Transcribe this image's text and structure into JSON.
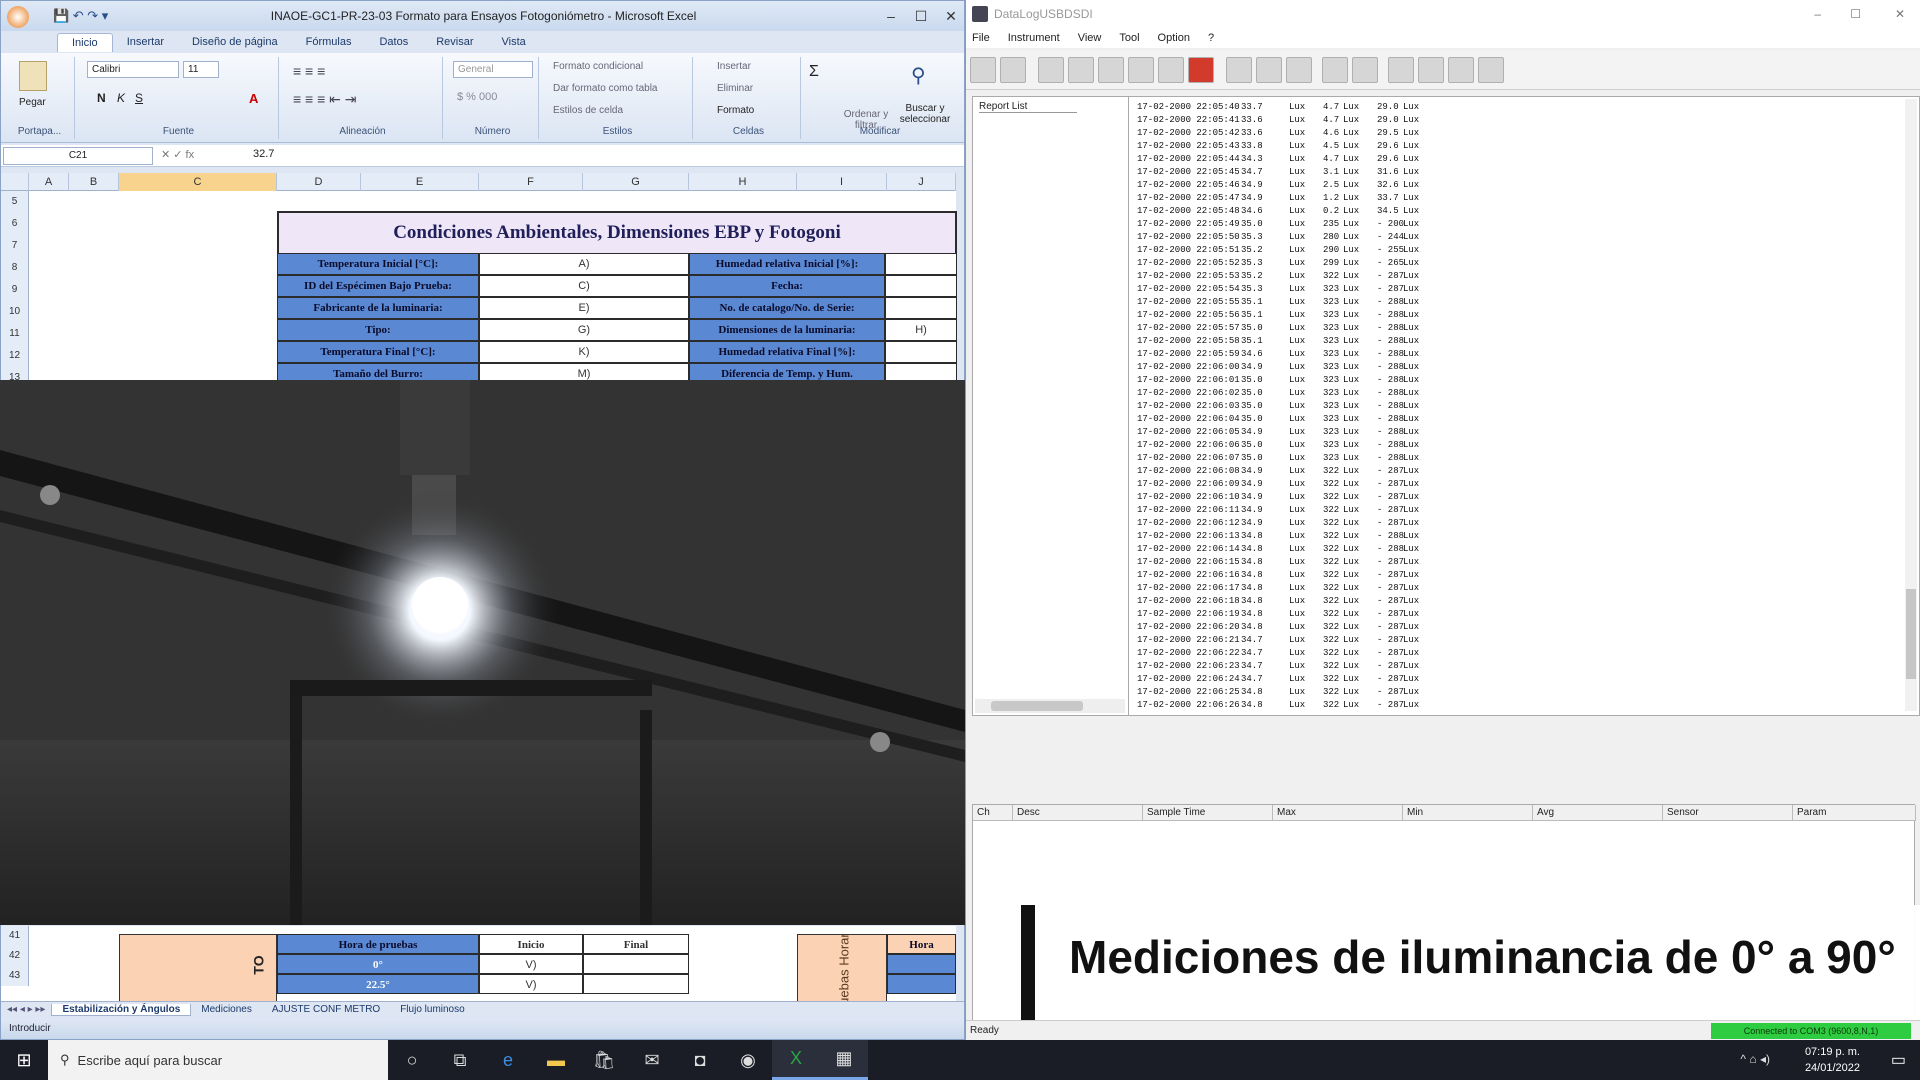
{
  "excel": {
    "title": "INAOE-GC1-PR-23-03 Formato para Ensayos Fotogoniómetro - Microsoft Excel",
    "tabs": [
      "Inicio",
      "Insertar",
      "Diseño de página",
      "Fórmulas",
      "Datos",
      "Revisar",
      "Vista"
    ],
    "ribbon": {
      "paste": "Pegar",
      "font_name": "Calibri",
      "font_size": "11",
      "number_format": "General",
      "groups": [
        "Portapa...",
        "Fuente",
        "Alineación",
        "Número",
        "Estilos",
        "Celdas",
        "Modificar"
      ],
      "styles_items": [
        "Formato condicional",
        "Dar formato como tabla",
        "Estilos de celda"
      ],
      "cells_items": [
        "Insertar",
        "Eliminar",
        "Formato"
      ],
      "edit_items": [
        "Ordenar y filtrar",
        "Buscar y seleccionar"
      ]
    },
    "name_box": "C21",
    "formula": "32.7",
    "columns": [
      "A",
      "B",
      "C",
      "D",
      "E",
      "F",
      "G",
      "H",
      "I",
      "J"
    ],
    "rows": [
      "5",
      "6",
      "7",
      "8",
      "9",
      "10",
      "11",
      "12",
      "13"
    ],
    "table_title": "Condiciones Ambientales, Dimensiones EBP y Fotogoni",
    "table_rows": [
      {
        "label": "Temperatura Inicial [°C]:",
        "value": "A)",
        "label2": "Humedad relativa Inicial [%]:",
        "value2": ""
      },
      {
        "label": "ID del Espécimen Bajo Prueba:",
        "value": "C)",
        "label2": "Fecha:",
        "value2": ""
      },
      {
        "label": "Fabricante de la luminaria:",
        "value": "E)",
        "label2": "No. de catalogo/No. de Serie:",
        "value2": ""
      },
      {
        "label": "Tipo:",
        "value": "G)",
        "label2": "Dimensiones de la luminaria:",
        "value2": "H)"
      },
      {
        "label": "Temperatura Final [°C]:",
        "value": "K)",
        "label2": "Humedad relativa Final [%]:",
        "value2": ""
      },
      {
        "label": "Tamaño del Burro:",
        "value": "M)",
        "label2": "Diferencia de Temp. y Hum.",
        "value2": ""
      }
    ],
    "bottom_rows": [
      "41",
      "42",
      "43"
    ],
    "bottom_table": {
      "header": [
        "Hora de pruebas",
        "Inicio",
        "Final"
      ],
      "rows": [
        [
          "0°",
          "V)",
          ""
        ],
        [
          "22.5°",
          "V)",
          ""
        ]
      ],
      "side_label": "Pruebas Horario",
      "side_header": "Hora"
    },
    "sheet_tabs": [
      "Estabilización y Ángulos",
      "Mediciones",
      "AJUSTE CONF METRO",
      "Flujo luminoso"
    ],
    "status": "Introducir"
  },
  "datalogger": {
    "title": "DataLogUSBDSDI",
    "menu": [
      "File",
      "Instrument",
      "View",
      "Tool",
      "Option",
      "?"
    ],
    "tree_label": "Report List",
    "rows": [
      [
        "17-02-2000 22:05:40",
        "33.7",
        "Lux",
        "4.7",
        "Lux",
        "29.0",
        "Lux"
      ],
      [
        "17-02-2000 22:05:41",
        "33.6",
        "Lux",
        "4.7",
        "Lux",
        "29.0",
        "Lux"
      ],
      [
        "17-02-2000 22:05:42",
        "33.6",
        "Lux",
        "4.6",
        "Lux",
        "29.5",
        "Lux"
      ],
      [
        "17-02-2000 22:05:43",
        "33.8",
        "Lux",
        "4.5",
        "Lux",
        "29.6",
        "Lux"
      ],
      [
        "17-02-2000 22:05:44",
        "34.3",
        "Lux",
        "4.7",
        "Lux",
        "29.6",
        "Lux"
      ],
      [
        "17-02-2000 22:05:45",
        "34.7",
        "Lux",
        "3.1",
        "Lux",
        "31.6",
        "Lux"
      ],
      [
        "17-02-2000 22:05:46",
        "34.9",
        "Lux",
        "2.5",
        "Lux",
        "32.6",
        "Lux"
      ],
      [
        "17-02-2000 22:05:47",
        "34.9",
        "Lux",
        "1.2",
        "Lux",
        "33.7",
        "Lux"
      ],
      [
        "17-02-2000 22:05:48",
        "34.6",
        "Lux",
        "0.2",
        "Lux",
        "34.5",
        "Lux"
      ],
      [
        "17-02-2000 22:05:49",
        "35.0",
        "Lux",
        "235",
        "Lux",
        "- 200",
        "Lux"
      ],
      [
        "17-02-2000 22:05:50",
        "35.3",
        "Lux",
        "280",
        "Lux",
        "- 244",
        "Lux"
      ],
      [
        "17-02-2000 22:05:51",
        "35.2",
        "Lux",
        "290",
        "Lux",
        "- 255",
        "Lux"
      ],
      [
        "17-02-2000 22:05:52",
        "35.3",
        "Lux",
        "299",
        "Lux",
        "- 265",
        "Lux"
      ],
      [
        "17-02-2000 22:05:53",
        "35.2",
        "Lux",
        "322",
        "Lux",
        "- 287",
        "Lux"
      ],
      [
        "17-02-2000 22:05:54",
        "35.3",
        "Lux",
        "323",
        "Lux",
        "- 287",
        "Lux"
      ],
      [
        "17-02-2000 22:05:55",
        "35.1",
        "Lux",
        "323",
        "Lux",
        "- 288",
        "Lux"
      ],
      [
        "17-02-2000 22:05:56",
        "35.1",
        "Lux",
        "323",
        "Lux",
        "- 288",
        "Lux"
      ],
      [
        "17-02-2000 22:05:57",
        "35.0",
        "Lux",
        "323",
        "Lux",
        "- 288",
        "Lux"
      ],
      [
        "17-02-2000 22:05:58",
        "35.1",
        "Lux",
        "323",
        "Lux",
        "- 288",
        "Lux"
      ],
      [
        "17-02-2000 22:05:59",
        "34.6",
        "Lux",
        "323",
        "Lux",
        "- 288",
        "Lux"
      ],
      [
        "17-02-2000 22:06:00",
        "34.9",
        "Lux",
        "323",
        "Lux",
        "- 288",
        "Lux"
      ],
      [
        "17-02-2000 22:06:01",
        "35.0",
        "Lux",
        "323",
        "Lux",
        "- 288",
        "Lux"
      ],
      [
        "17-02-2000 22:06:02",
        "35.0",
        "Lux",
        "323",
        "Lux",
        "- 288",
        "Lux"
      ],
      [
        "17-02-2000 22:06:03",
        "35.0",
        "Lux",
        "323",
        "Lux",
        "- 288",
        "Lux"
      ],
      [
        "17-02-2000 22:06:04",
        "35.0",
        "Lux",
        "323",
        "Lux",
        "- 288",
        "Lux"
      ],
      [
        "17-02-2000 22:06:05",
        "34.9",
        "Lux",
        "323",
        "Lux",
        "- 288",
        "Lux"
      ],
      [
        "17-02-2000 22:06:06",
        "35.0",
        "Lux",
        "323",
        "Lux",
        "- 288",
        "Lux"
      ],
      [
        "17-02-2000 22:06:07",
        "35.0",
        "Lux",
        "323",
        "Lux",
        "- 288",
        "Lux"
      ],
      [
        "17-02-2000 22:06:08",
        "34.9",
        "Lux",
        "322",
        "Lux",
        "- 287",
        "Lux"
      ],
      [
        "17-02-2000 22:06:09",
        "34.9",
        "Lux",
        "322",
        "Lux",
        "- 287",
        "Lux"
      ],
      [
        "17-02-2000 22:06:10",
        "34.9",
        "Lux",
        "322",
        "Lux",
        "- 287",
        "Lux"
      ],
      [
        "17-02-2000 22:06:11",
        "34.9",
        "Lux",
        "322",
        "Lux",
        "- 287",
        "Lux"
      ],
      [
        "17-02-2000 22:06:12",
        "34.9",
        "Lux",
        "322",
        "Lux",
        "- 287",
        "Lux"
      ],
      [
        "17-02-2000 22:06:13",
        "34.8",
        "Lux",
        "322",
        "Lux",
        "- 288",
        "Lux"
      ],
      [
        "17-02-2000 22:06:14",
        "34.8",
        "Lux",
        "322",
        "Lux",
        "- 288",
        "Lux"
      ],
      [
        "17-02-2000 22:06:15",
        "34.8",
        "Lux",
        "322",
        "Lux",
        "- 287",
        "Lux"
      ],
      [
        "17-02-2000 22:06:16",
        "34.8",
        "Lux",
        "322",
        "Lux",
        "- 287",
        "Lux"
      ],
      [
        "17-02-2000 22:06:17",
        "34.8",
        "Lux",
        "322",
        "Lux",
        "- 287",
        "Lux"
      ],
      [
        "17-02-2000 22:06:18",
        "34.8",
        "Lux",
        "322",
        "Lux",
        "- 287",
        "Lux"
      ],
      [
        "17-02-2000 22:06:19",
        "34.8",
        "Lux",
        "322",
        "Lux",
        "- 287",
        "Lux"
      ],
      [
        "17-02-2000 22:06:20",
        "34.8",
        "Lux",
        "322",
        "Lux",
        "- 287",
        "Lux"
      ],
      [
        "17-02-2000 22:06:21",
        "34.7",
        "Lux",
        "322",
        "Lux",
        "- 287",
        "Lux"
      ],
      [
        "17-02-2000 22:06:22",
        "34.7",
        "Lux",
        "322",
        "Lux",
        "- 287",
        "Lux"
      ],
      [
        "17-02-2000 22:06:23",
        "34.7",
        "Lux",
        "322",
        "Lux",
        "- 287",
        "Lux"
      ],
      [
        "17-02-2000 22:06:24",
        "34.7",
        "Lux",
        "322",
        "Lux",
        "- 287",
        "Lux"
      ],
      [
        "17-02-2000 22:06:25",
        "34.8",
        "Lux",
        "322",
        "Lux",
        "- 287",
        "Lux"
      ],
      [
        "17-02-2000 22:06:26",
        "34.8",
        "Lux",
        "322",
        "Lux",
        "- 287",
        "Lux"
      ]
    ],
    "bottom_headers": [
      "Ch",
      "Desc",
      "Sample Time",
      "Max",
      "Min",
      "Avg",
      "Sensor",
      "Param"
    ],
    "status": "Ready",
    "connection": "Connected to COM3 (9600,8,N,1)"
  },
  "caption": "Mediciones de iluminancia de 0° a 90°",
  "taskbar": {
    "search_placeholder": "Escribe aquí para buscar",
    "time": "07:19 p. m.",
    "date": "24/01/2022"
  },
  "colors": {
    "label_blue": "#5a88d3",
    "title_purple": "#efe6f7",
    "selected_col": "#f8d38e",
    "connection_green": "#2ecc40"
  }
}
